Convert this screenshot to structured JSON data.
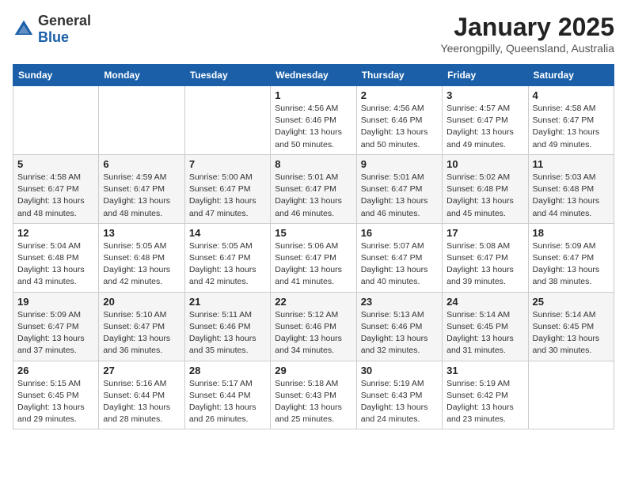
{
  "header": {
    "logo_general": "General",
    "logo_blue": "Blue",
    "title": "January 2025",
    "subtitle": "Yeerongpilly, Queensland, Australia"
  },
  "days": [
    "Sunday",
    "Monday",
    "Tuesday",
    "Wednesday",
    "Thursday",
    "Friday",
    "Saturday"
  ],
  "weeks": [
    [
      {
        "num": "",
        "info": ""
      },
      {
        "num": "",
        "info": ""
      },
      {
        "num": "",
        "info": ""
      },
      {
        "num": "1",
        "info": "Sunrise: 4:56 AM\nSunset: 6:46 PM\nDaylight: 13 hours and 50 minutes."
      },
      {
        "num": "2",
        "info": "Sunrise: 4:56 AM\nSunset: 6:46 PM\nDaylight: 13 hours and 50 minutes."
      },
      {
        "num": "3",
        "info": "Sunrise: 4:57 AM\nSunset: 6:47 PM\nDaylight: 13 hours and 49 minutes."
      },
      {
        "num": "4",
        "info": "Sunrise: 4:58 AM\nSunset: 6:47 PM\nDaylight: 13 hours and 49 minutes."
      }
    ],
    [
      {
        "num": "5",
        "info": "Sunrise: 4:58 AM\nSunset: 6:47 PM\nDaylight: 13 hours and 48 minutes."
      },
      {
        "num": "6",
        "info": "Sunrise: 4:59 AM\nSunset: 6:47 PM\nDaylight: 13 hours and 48 minutes."
      },
      {
        "num": "7",
        "info": "Sunrise: 5:00 AM\nSunset: 6:47 PM\nDaylight: 13 hours and 47 minutes."
      },
      {
        "num": "8",
        "info": "Sunrise: 5:01 AM\nSunset: 6:47 PM\nDaylight: 13 hours and 46 minutes."
      },
      {
        "num": "9",
        "info": "Sunrise: 5:01 AM\nSunset: 6:47 PM\nDaylight: 13 hours and 46 minutes."
      },
      {
        "num": "10",
        "info": "Sunrise: 5:02 AM\nSunset: 6:48 PM\nDaylight: 13 hours and 45 minutes."
      },
      {
        "num": "11",
        "info": "Sunrise: 5:03 AM\nSunset: 6:48 PM\nDaylight: 13 hours and 44 minutes."
      }
    ],
    [
      {
        "num": "12",
        "info": "Sunrise: 5:04 AM\nSunset: 6:48 PM\nDaylight: 13 hours and 43 minutes."
      },
      {
        "num": "13",
        "info": "Sunrise: 5:05 AM\nSunset: 6:48 PM\nDaylight: 13 hours and 42 minutes."
      },
      {
        "num": "14",
        "info": "Sunrise: 5:05 AM\nSunset: 6:47 PM\nDaylight: 13 hours and 42 minutes."
      },
      {
        "num": "15",
        "info": "Sunrise: 5:06 AM\nSunset: 6:47 PM\nDaylight: 13 hours and 41 minutes."
      },
      {
        "num": "16",
        "info": "Sunrise: 5:07 AM\nSunset: 6:47 PM\nDaylight: 13 hours and 40 minutes."
      },
      {
        "num": "17",
        "info": "Sunrise: 5:08 AM\nSunset: 6:47 PM\nDaylight: 13 hours and 39 minutes."
      },
      {
        "num": "18",
        "info": "Sunrise: 5:09 AM\nSunset: 6:47 PM\nDaylight: 13 hours and 38 minutes."
      }
    ],
    [
      {
        "num": "19",
        "info": "Sunrise: 5:09 AM\nSunset: 6:47 PM\nDaylight: 13 hours and 37 minutes."
      },
      {
        "num": "20",
        "info": "Sunrise: 5:10 AM\nSunset: 6:47 PM\nDaylight: 13 hours and 36 minutes."
      },
      {
        "num": "21",
        "info": "Sunrise: 5:11 AM\nSunset: 6:46 PM\nDaylight: 13 hours and 35 minutes."
      },
      {
        "num": "22",
        "info": "Sunrise: 5:12 AM\nSunset: 6:46 PM\nDaylight: 13 hours and 34 minutes."
      },
      {
        "num": "23",
        "info": "Sunrise: 5:13 AM\nSunset: 6:46 PM\nDaylight: 13 hours and 32 minutes."
      },
      {
        "num": "24",
        "info": "Sunrise: 5:14 AM\nSunset: 6:45 PM\nDaylight: 13 hours and 31 minutes."
      },
      {
        "num": "25",
        "info": "Sunrise: 5:14 AM\nSunset: 6:45 PM\nDaylight: 13 hours and 30 minutes."
      }
    ],
    [
      {
        "num": "26",
        "info": "Sunrise: 5:15 AM\nSunset: 6:45 PM\nDaylight: 13 hours and 29 minutes."
      },
      {
        "num": "27",
        "info": "Sunrise: 5:16 AM\nSunset: 6:44 PM\nDaylight: 13 hours and 28 minutes."
      },
      {
        "num": "28",
        "info": "Sunrise: 5:17 AM\nSunset: 6:44 PM\nDaylight: 13 hours and 26 minutes."
      },
      {
        "num": "29",
        "info": "Sunrise: 5:18 AM\nSunset: 6:43 PM\nDaylight: 13 hours and 25 minutes."
      },
      {
        "num": "30",
        "info": "Sunrise: 5:19 AM\nSunset: 6:43 PM\nDaylight: 13 hours and 24 minutes."
      },
      {
        "num": "31",
        "info": "Sunrise: 5:19 AM\nSunset: 6:42 PM\nDaylight: 13 hours and 23 minutes."
      },
      {
        "num": "",
        "info": ""
      }
    ]
  ]
}
